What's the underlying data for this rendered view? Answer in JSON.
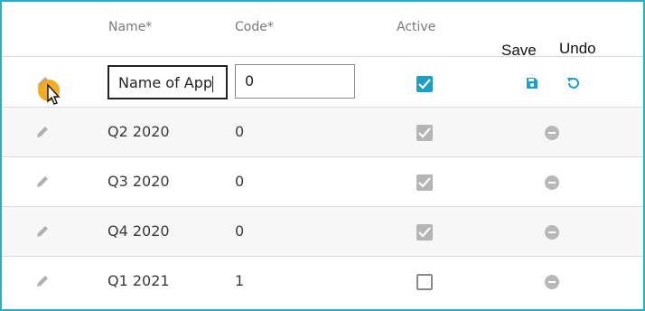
{
  "columns": {
    "name": "Name*",
    "code": "Code*",
    "active": "Active"
  },
  "actions": {
    "save_label": "Save",
    "undo_label": "Undo"
  },
  "edit_row": {
    "name_value": "Name of App",
    "code_value": "0",
    "active": true
  },
  "rows": [
    {
      "name": "Q2 2020",
      "code": "0",
      "active": true
    },
    {
      "name": "Q3 2020",
      "code": "0",
      "active": true
    },
    {
      "name": "Q4 2020",
      "code": "0",
      "active": true
    },
    {
      "name": "Q1 2021",
      "code": "1",
      "active": false
    }
  ],
  "icons": {
    "edit": "pencil-icon",
    "save": "floppy-disk-icon",
    "undo": "undo-icon",
    "remove": "minus-circle-icon",
    "check": "checkmark-icon",
    "pointer": "mouse-pointer-icon"
  },
  "colors": {
    "accent": "#1da0c4",
    "frame": "#27aec9",
    "highlight": "#f0a30a"
  }
}
